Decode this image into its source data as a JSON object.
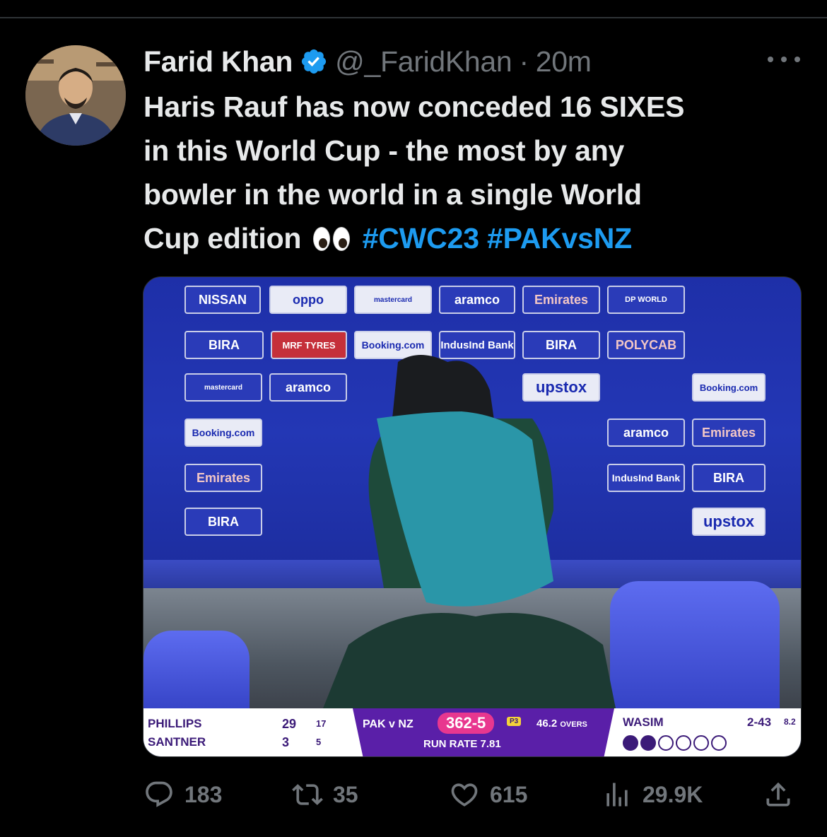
{
  "author": {
    "name": "Farid Khan",
    "handle": "@_FaridKhan",
    "separator": "·",
    "time": "20m"
  },
  "tweet": {
    "lines": [
      "Haris Rauf has now conceded 16 SIXES",
      "in this World Cup - the most by any",
      "bowler in the world in a single World"
    ],
    "last_line_text": "Cup edition",
    "hashtags": [
      "#CWC23",
      "#PAKvsNZ"
    ]
  },
  "media": {
    "sponsors": [
      "NISSAN",
      "oppo",
      "mastercard",
      "aramco",
      "Emirates",
      "DP WORLD",
      "BIRA",
      "MRF TYRES",
      "Booking.com",
      "IndusInd Bank",
      "POLYCAB",
      "upstox"
    ],
    "scorebar": {
      "batter1": {
        "name": "PHILLIPS",
        "runs": "29",
        "balls": "17"
      },
      "batter2": {
        "name": "SANTNER",
        "runs": "3",
        "balls": "5"
      },
      "teams": "PAK v NZ",
      "score": "362-5",
      "powerplay": "P3",
      "overs": "46.2",
      "overs_label": "OVERS",
      "run_rate": "RUN RATE 7.81",
      "bowler": "WASIM",
      "figures": "2-43",
      "economy": "8.2",
      "balls_bowled": 2,
      "balls_total": 6
    }
  },
  "actions": {
    "replies": "183",
    "reposts": "35",
    "likes": "615",
    "views": "29.9K"
  },
  "colors": {
    "background": "#000000",
    "text": "#e7e9ea",
    "muted": "#71767b",
    "accent": "#1d9bf0"
  }
}
